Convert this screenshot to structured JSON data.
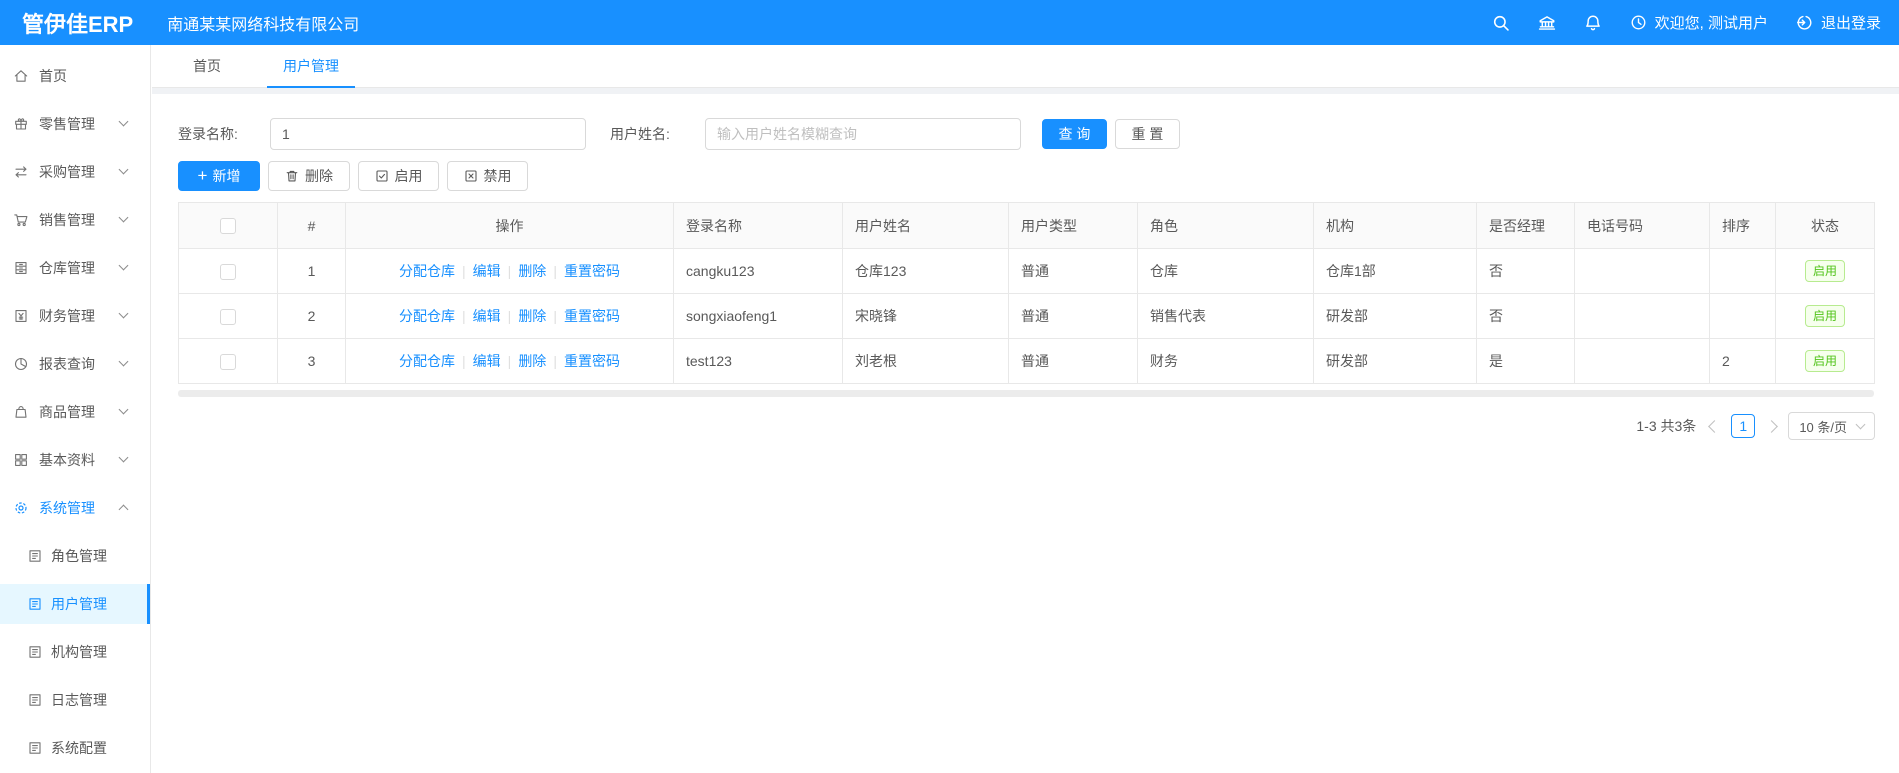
{
  "topbar": {
    "logo": "管伊佳ERP",
    "company": "南通某某网络科技有限公司",
    "welcome": "欢迎您, 测试用户",
    "logout": "退出登录"
  },
  "tabs": {
    "home": "首页",
    "current": "用户管理"
  },
  "sidebar": {
    "items": [
      {
        "label": "首页"
      },
      {
        "label": "零售管理"
      },
      {
        "label": "采购管理"
      },
      {
        "label": "销售管理"
      },
      {
        "label": "仓库管理"
      },
      {
        "label": "财务管理"
      },
      {
        "label": "报表查询"
      },
      {
        "label": "商品管理"
      },
      {
        "label": "基本资料"
      },
      {
        "label": "系统管理"
      }
    ],
    "subitems": [
      {
        "label": "角色管理"
      },
      {
        "label": "用户管理"
      },
      {
        "label": "机构管理"
      },
      {
        "label": "日志管理"
      },
      {
        "label": "系统配置"
      }
    ]
  },
  "filter": {
    "login_label": "登录名称:",
    "login_value": "1",
    "name_label": "用户姓名:",
    "name_placeholder": "输入用户姓名模糊查询",
    "search": "查 询",
    "reset": "重 置"
  },
  "actions": {
    "add": "新增",
    "remove": "删除",
    "enable": "启用",
    "disable": "禁用"
  },
  "table": {
    "headers": [
      "#",
      "操作",
      "登录名称",
      "用户姓名",
      "用户类型",
      "角色",
      "机构",
      "是否经理",
      "电话号码",
      "排序",
      "状态"
    ],
    "ops": [
      "分配仓库",
      "编辑",
      "删除",
      "重置密码"
    ],
    "rows": [
      {
        "index": "1",
        "login": "cangku123",
        "name": "仓库123",
        "type": "普通",
        "role": "仓库",
        "org": "仓库1部",
        "manager": "否",
        "phone": "",
        "sort": "",
        "status": "启用"
      },
      {
        "index": "2",
        "login": "songxiaofeng1",
        "name": "宋晓锋",
        "type": "普通",
        "role": "销售代表",
        "org": "研发部",
        "manager": "否",
        "phone": "",
        "sort": "",
        "status": "启用"
      },
      {
        "index": "3",
        "login": "test123",
        "name": "刘老根",
        "type": "普通",
        "role": "财务",
        "org": "研发部",
        "manager": "是",
        "phone": "",
        "sort": "2",
        "status": "启用"
      }
    ]
  },
  "pagination": {
    "total": "1-3 共3条",
    "page": "1",
    "page_size": "10 条/页"
  },
  "colors": {
    "primary": "#1890ff",
    "success": "#52c41a"
  }
}
